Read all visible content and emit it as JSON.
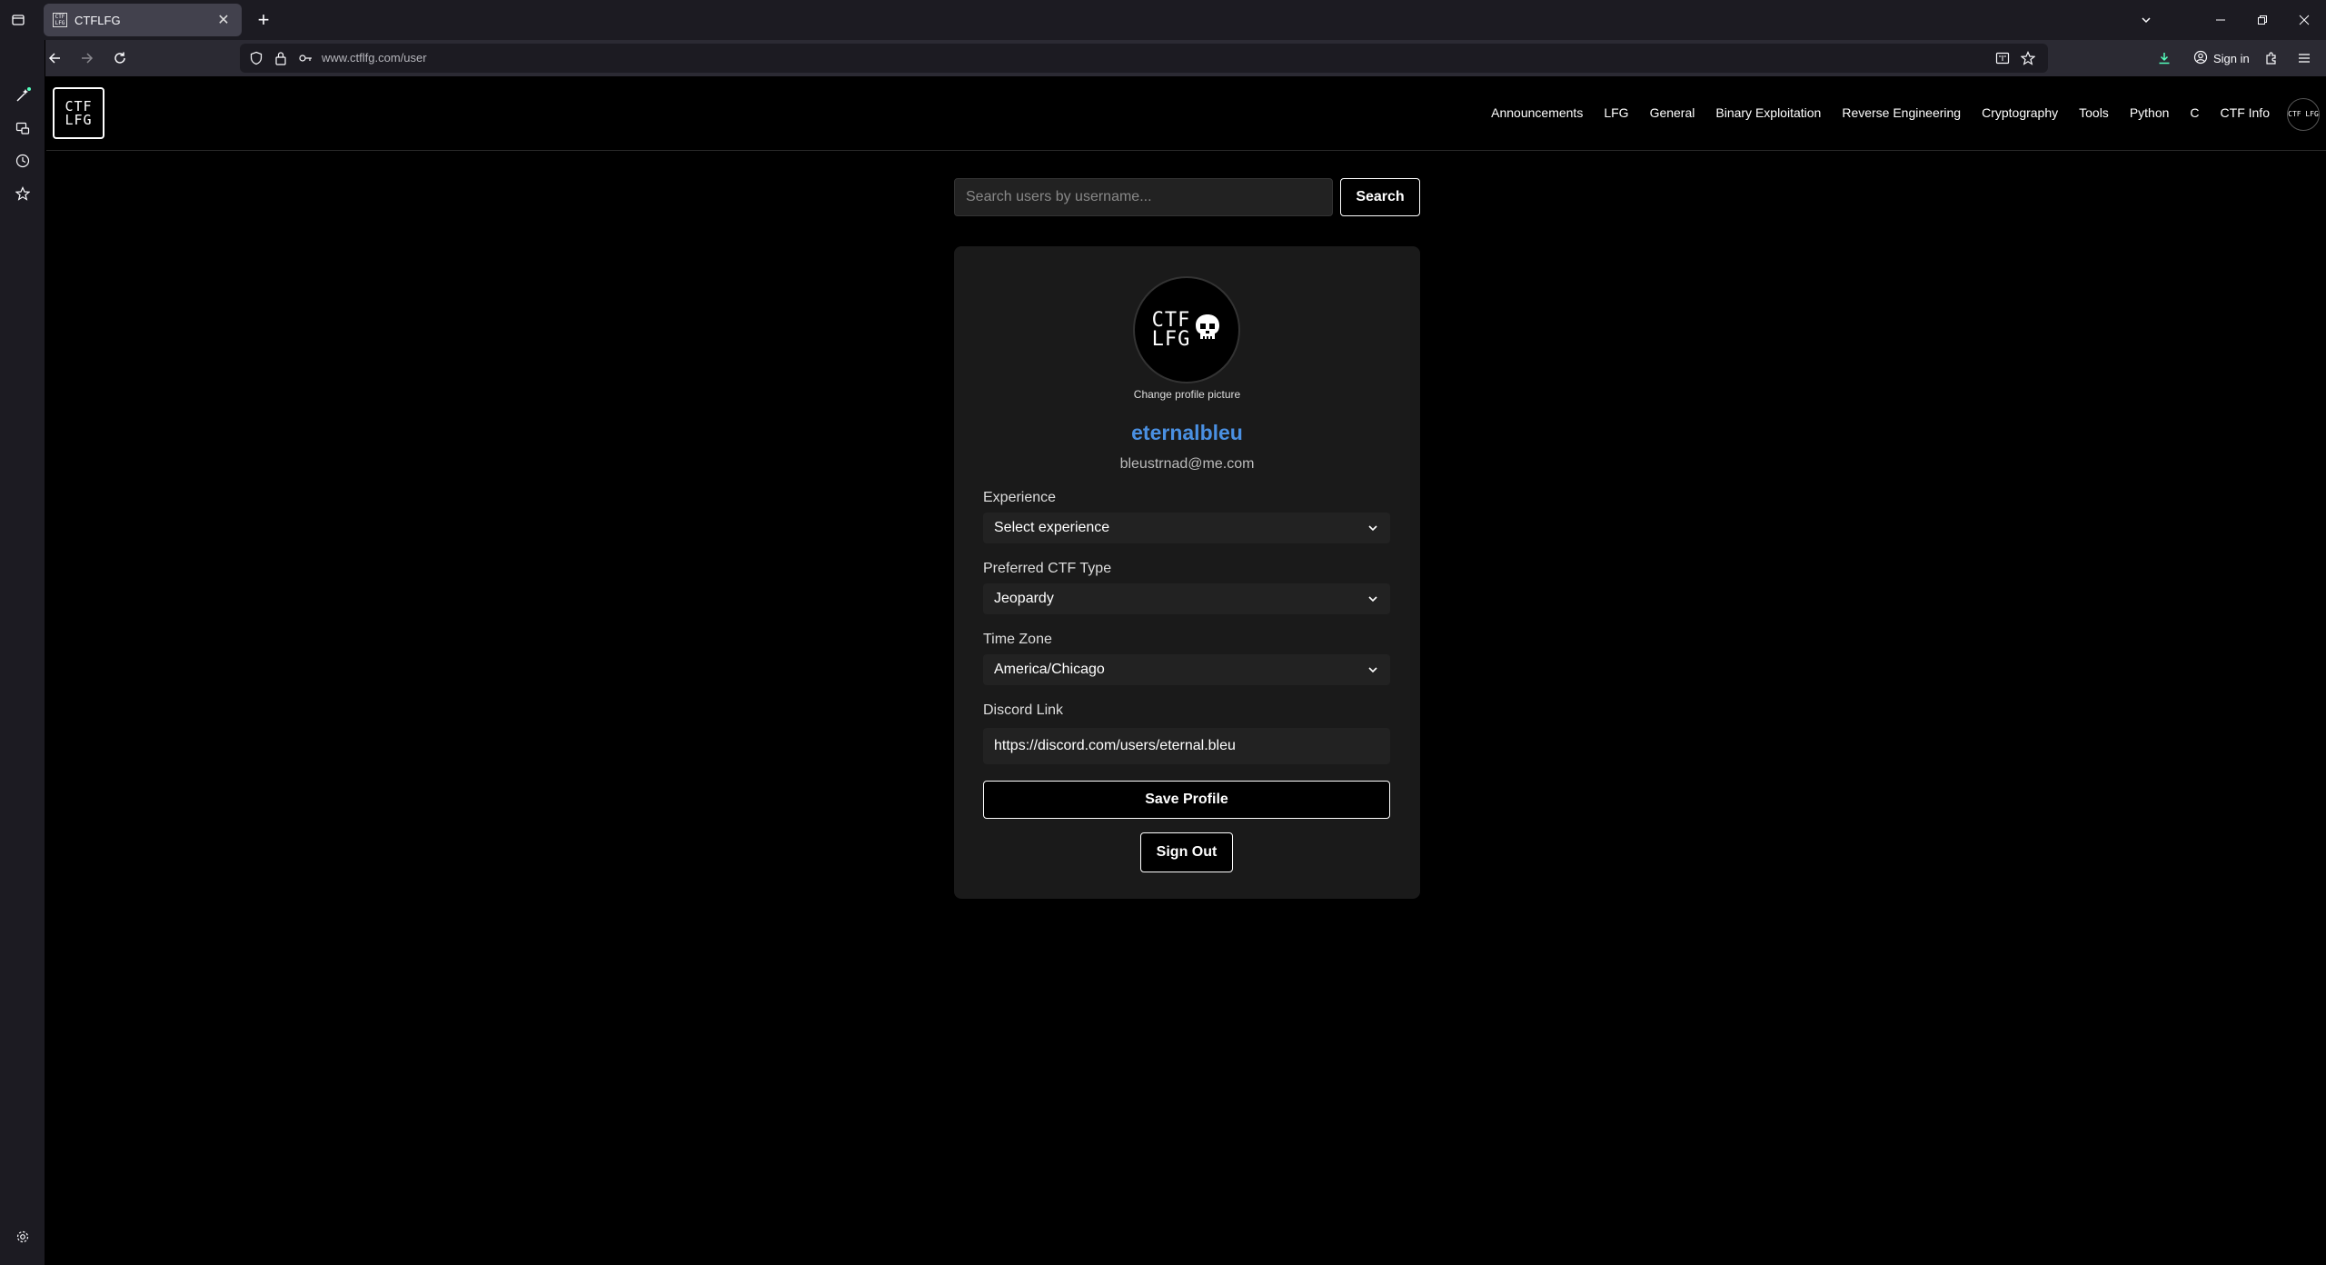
{
  "browser": {
    "tab_title": "CTFLFG",
    "favicon_text": "CTF LFG",
    "url_host": "www.ctflfg.com",
    "url_path": "/user",
    "signin_label": "Sign in",
    "icons": [
      "tab-list-icon",
      "close-icon",
      "new-tab-icon",
      "list-all-tabs-icon",
      "minimize-icon",
      "restore-icon",
      "window-close-icon",
      "sidebar-toggle-icon",
      "back-icon",
      "forward-icon",
      "reload-icon",
      "shield-icon",
      "lock-icon",
      "key-icon",
      "reader-view-icon",
      "bookmark-star-icon",
      "download-icon",
      "account-icon",
      "extensions-icon",
      "menu-icon"
    ]
  },
  "sidebar": {
    "icons": [
      "ai-chatbot-icon",
      "synced-tabs-icon",
      "history-icon",
      "bookmarks-icon",
      "settings-icon"
    ]
  },
  "site": {
    "logo_line1": "CTF",
    "logo_line2": "LFG",
    "nav": [
      "Announcements",
      "LFG",
      "General",
      "Binary Exploitation",
      "Reverse Engineering",
      "Cryptography",
      "Tools",
      "Python",
      "C",
      "CTF Info"
    ],
    "header_avatar_text": "CTF LFG"
  },
  "search": {
    "placeholder": "Search users by username...",
    "button_label": "Search"
  },
  "profile": {
    "avatar_line1": "CTF",
    "avatar_line2": "LFG",
    "change_picture_label": "Change profile picture",
    "username": "eternalbleu",
    "email": "bleustrnad@me.com",
    "experience_label": "Experience",
    "experience_value": "Select experience",
    "ctf_type_label": "Preferred CTF Type",
    "ctf_type_value": "Jeopardy",
    "timezone_label": "Time Zone",
    "timezone_value": "America/Chicago",
    "discord_label": "Discord Link",
    "discord_value": "https://discord.com/users/eternal.bleu",
    "save_label": "Save Profile",
    "signout_label": "Sign Out",
    "username_color": "#4a90e2"
  }
}
